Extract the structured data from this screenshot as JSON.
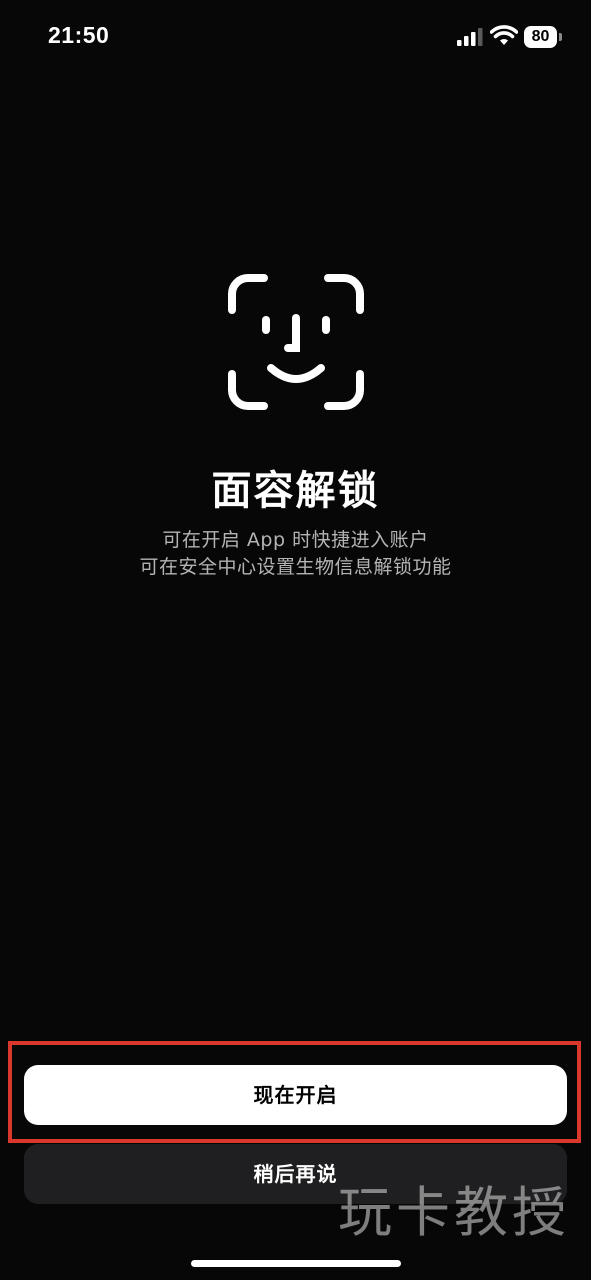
{
  "status_bar": {
    "time": "21:50",
    "battery_level": "80",
    "icons": [
      "signal-icon",
      "wifi-icon",
      "battery-icon"
    ]
  },
  "main": {
    "icon": "face-id-icon",
    "title": "面容解锁",
    "subtitle_line1": "可在开启 App 时快捷进入账户",
    "subtitle_line2": "可在安全中心设置生物信息解锁功能"
  },
  "actions": {
    "enable_label": "现在开启",
    "later_label": "稍后再说"
  },
  "watermark": {
    "text": "玩卡教授"
  },
  "colors": {
    "background": "#070707",
    "primary_button": "#ffffff",
    "secondary_button": "#1f1f21",
    "highlight_border": "#d9392c",
    "subtitle_text": "#b4b4b4"
  }
}
